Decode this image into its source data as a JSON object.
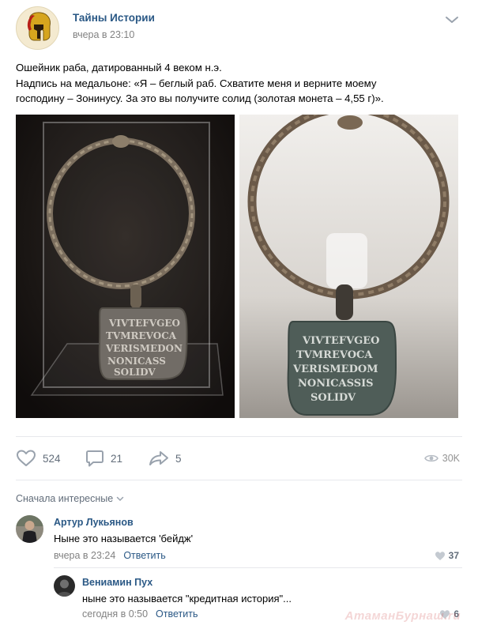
{
  "post": {
    "group_name": "Тайны Истории",
    "time": "вчера в 23:10",
    "text_lines": [
      "Ошейник раба, датированный 4 веком н.э.",
      "Надпись на медальоне: «Я – беглый раб. Схватите меня и верните моему",
      "господину – Зонинусу. За это вы получите солид (золотая монета – 4,55 г)»."
    ],
    "photo_left_alt": "",
    "photo_right_alt": ""
  },
  "actions": {
    "likes": "524",
    "comments": "21",
    "shares": "5",
    "views": "30K"
  },
  "sort_label": "Сначала интересные",
  "comments": [
    {
      "author": "Артур Лукьянов",
      "text": "Ныне это называется 'бейдж'",
      "time": "вчера в 23:24",
      "reply_label": "Ответить",
      "likes": "37"
    },
    {
      "author": "Вениамин Пух",
      "text": "ныне это называется \"кредитная история\"...",
      "time": "сегодня в 0:50",
      "reply_label": "Ответить",
      "likes": "6"
    }
  ],
  "watermark": "АтаманБурнаш.ru",
  "colors": {
    "link": "#2a5885",
    "muted": "#828282",
    "icon": "#99a2ad",
    "divider": "#e7e8ec"
  },
  "icons": [
    "chevron-down-icon",
    "heart-icon",
    "comment-icon",
    "share-icon",
    "eye-icon",
    "small-heart-icon"
  ]
}
